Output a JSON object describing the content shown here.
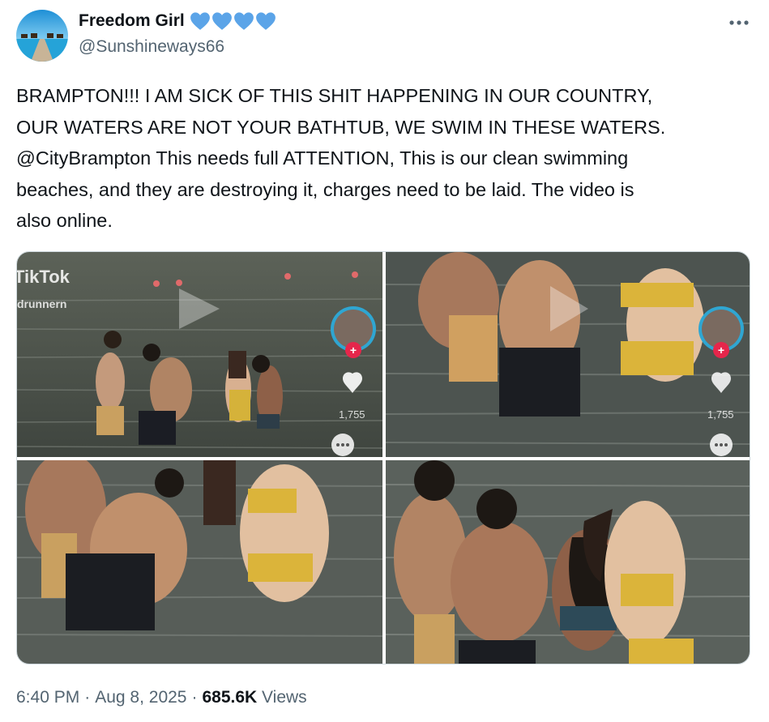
{
  "tweet": {
    "author": {
      "display_name": "Freedom Girl",
      "handle": "@Sunshineways66",
      "name_emoji": [
        "blue-heart",
        "blue-heart",
        "blue-heart",
        "blue-heart"
      ]
    },
    "text": "BRAMPTON!!! I AM SICK OF THIS SHIT HAPPENING IN OUR COUNTRY,\nOUR WATERS ARE NOT YOUR BATHTUB, WE SWIM IN THESE WATERS.\n@CityBrampton This needs full ATTENTION, This is our clean swimming\nbeaches, and they are destroying it, charges need to be laid. The video is\nalso online.",
    "media": {
      "overlay": {
        "watermark_app": "TikTok",
        "watermark_user": "drunnern",
        "like_count": "1,755"
      }
    },
    "meta": {
      "time": "6:40 PM",
      "sep1": "·",
      "date": "Aug 8, 2025",
      "sep2": "·",
      "views_count": "685.6K",
      "views_label": "Views"
    }
  },
  "colors": {
    "text_primary": "#0f1419",
    "text_secondary": "#536471",
    "heart_blue": "#5ba4e8",
    "border": "#cfd9de",
    "tiktok_plus": "#e6264b"
  }
}
